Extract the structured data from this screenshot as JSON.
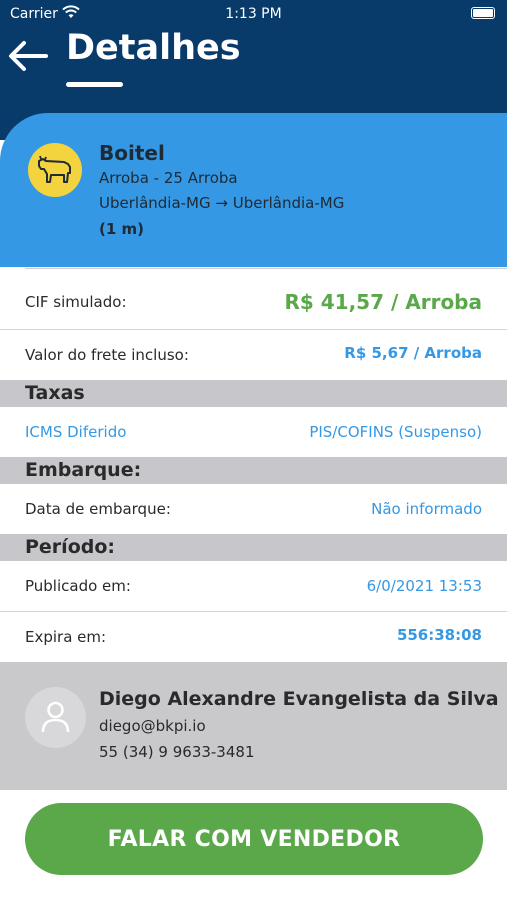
{
  "status_bar": {
    "carrier": "Carrier",
    "time": "1:13 PM"
  },
  "header": {
    "title": "Detalhes"
  },
  "product": {
    "name": "Boitel",
    "unit_line": "Arroba - 25 Arroba",
    "route": "Uberlândia-MG → Uberlândia-MG",
    "duration": "(1 m)",
    "icon": "cow-icon"
  },
  "pricing": {
    "cif_label": "CIF simulado:",
    "cif_value": "R$ 41,57 / Arroba",
    "freight_label": "Valor do frete incluso:",
    "freight_value": "R$ 5,67 / Arroba"
  },
  "taxes": {
    "header": "Taxas",
    "icms": "ICMS Diferido",
    "pis_cofins": "PIS/COFINS (Suspenso)"
  },
  "shipping": {
    "header": "Embarque:",
    "date_label": "Data de embarque:",
    "date_value": "Não informado"
  },
  "period": {
    "header": "Período:",
    "published_label": "Publicado em:",
    "published_value": "6/0/2021 13:53",
    "expires_label": "Expira em:",
    "expires_value": "556:38:08"
  },
  "seller": {
    "name": "Diego Alexandre Evangelista da Silva",
    "email": "diego@bkpi.io",
    "phone": "55 (34) 9 9633-3481"
  },
  "cta": {
    "label": "FALAR COM VENDEDOR"
  },
  "colors": {
    "header_bg": "#083a6a",
    "card_bg": "#3598e4",
    "accent_blue": "#3598e4",
    "price_green": "#5aa84a",
    "cta_green": "#5aa84a",
    "section_gray": "#c7c7cb"
  }
}
